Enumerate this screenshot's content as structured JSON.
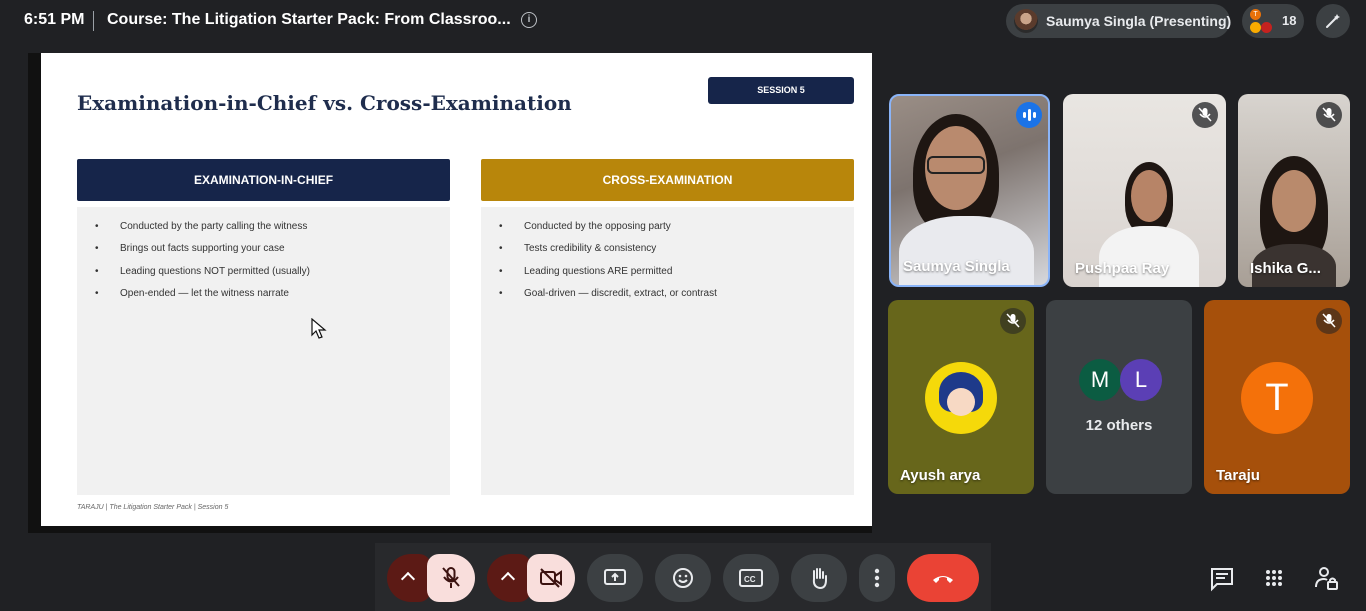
{
  "topbar": {
    "time": "6:51 PM",
    "meeting_title": "Course: The Litigation Starter Pack: From Classroo...",
    "info_icon": "info-icon",
    "presenter": "Saumya Singla (Presenting)",
    "participant_count": "18",
    "participant_avatar_letter": "T"
  },
  "slide": {
    "title": "Examination-in-Chief vs. Cross-Examination",
    "session_badge": "SESSION 5",
    "left_column": {
      "heading": "EXAMINATION-IN-CHIEF",
      "bullets": [
        "Conducted by the party calling the witness",
        "Brings out facts supporting your case",
        "Leading questions NOT permitted (usually)",
        "Open-ended — let the witness narrate"
      ]
    },
    "right_column": {
      "heading": "CROSS-EXAMINATION",
      "bullets": [
        "Conducted by the opposing party",
        "Tests credibility & consistency",
        "Leading questions ARE permitted",
        "Goal-driven — discredit, extract, or contrast"
      ]
    },
    "footer": "TARAJU  |  The Litigation Starter Pack  |  Session 5",
    "colors": {
      "navy": "#16254a",
      "gold": "#b8860b"
    }
  },
  "tiles": {
    "saumya": {
      "name": "Saumya Singla",
      "status": "speaking"
    },
    "pushpaa": {
      "name": "Pushpaa Ray",
      "status": "muted"
    },
    "ishika": {
      "name": "Ishika G...",
      "status": "muted"
    },
    "ayush": {
      "name": "Ayush arya",
      "status": "muted"
    },
    "others": {
      "label": "12 others",
      "avatar_m": "M",
      "avatar_l": "L"
    },
    "taraju": {
      "name": "Taraju",
      "avatar_letter": "T",
      "status": "muted"
    }
  },
  "controls": {
    "mic": "mic-off-icon",
    "camera": "camera-off-icon",
    "present": "present-screen-icon",
    "reactions": "emoji-icon",
    "captions": "captions-icon",
    "raise_hand": "raise-hand-icon",
    "more": "more-options-icon",
    "leave": "end-call-icon",
    "chat": "chat-icon",
    "activities": "apps-grid-icon",
    "host_controls": "lock-person-icon"
  }
}
